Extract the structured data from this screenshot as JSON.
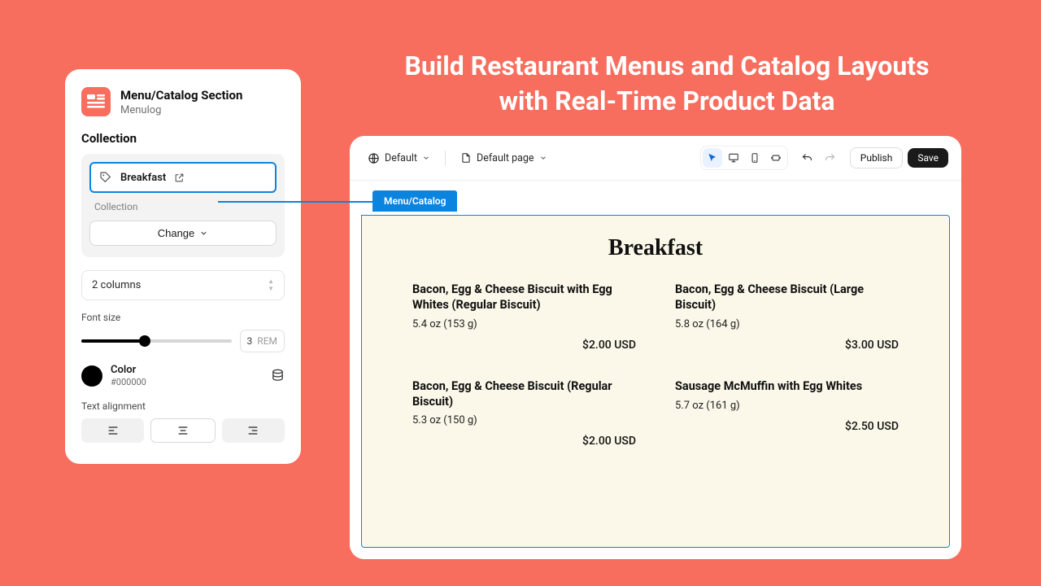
{
  "headline_line1": "Build Restaurant Menus and Catalog Layouts",
  "headline_line2": "with Real-Time Product Data",
  "panel": {
    "title": "Menu/Catalog Section",
    "subtitle": "Menulog",
    "section_label": "Collection",
    "chip_label": "Breakfast",
    "collection_sublabel": "Collection",
    "change_label": "Change",
    "columns_label": "2 columns",
    "fontsize_label": "Font size",
    "fontsize_value": "3",
    "fontsize_unit": "REM",
    "color_label": "Color",
    "color_hex": "#000000",
    "text_align_label": "Text alignment"
  },
  "toolbar": {
    "preset_label": "Default",
    "page_label": "Default page",
    "publish_label": "Publish",
    "save_label": "Save"
  },
  "canvas": {
    "tab_label": "Menu/Catalog",
    "menu_title": "Breakfast",
    "items": [
      {
        "name": "Bacon, Egg & Cheese Biscuit with Egg Whites (Regular Biscuit)",
        "sub": "5.4 oz (153 g)",
        "price": "$2.00 USD"
      },
      {
        "name": "Bacon, Egg & Cheese Biscuit (Large Biscuit)",
        "sub": "5.8 oz (164 g)",
        "price": "$3.00 USD"
      },
      {
        "name": "Bacon, Egg & Cheese Biscuit (Regular Biscuit)",
        "sub": "5.3 oz (150 g)",
        "price": "$2.00 USD"
      },
      {
        "name": "Sausage McMuffin with Egg Whites",
        "sub": "5.7 oz (161 g)",
        "price": "$2.50 USD"
      }
    ]
  }
}
